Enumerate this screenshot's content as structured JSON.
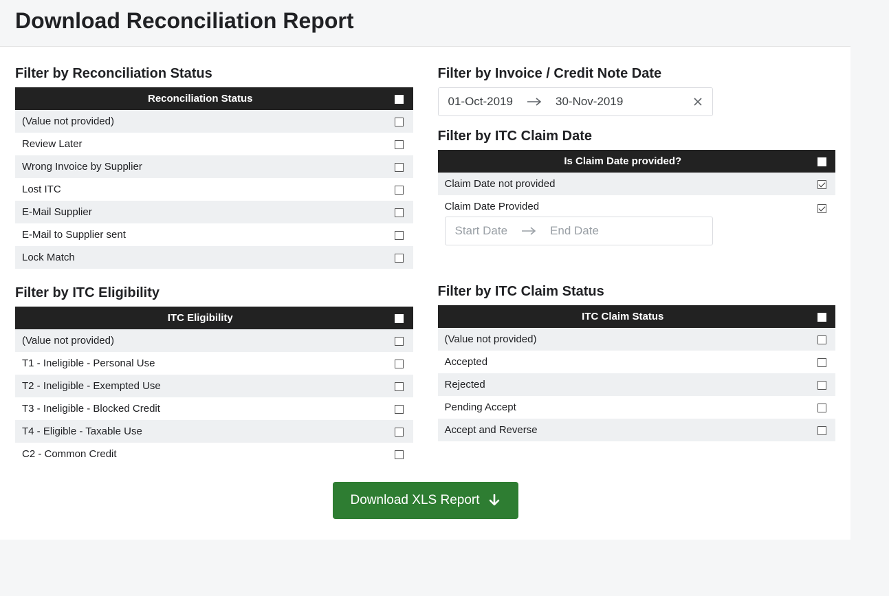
{
  "header": {
    "title": "Download Reconciliation Report"
  },
  "recon_status": {
    "title": "Filter by Reconciliation Status",
    "column_label": "Reconciliation Status",
    "rows": [
      {
        "label": "(Value not provided)",
        "checked": false
      },
      {
        "label": "Review Later",
        "checked": false
      },
      {
        "label": "Wrong Invoice by Supplier",
        "checked": false
      },
      {
        "label": "Lost ITC",
        "checked": false
      },
      {
        "label": "E-Mail Supplier",
        "checked": false
      },
      {
        "label": "E-Mail to Supplier sent",
        "checked": false
      },
      {
        "label": "Lock Match",
        "checked": false
      }
    ]
  },
  "invoice_date": {
    "title": "Filter by Invoice / Credit Note Date",
    "start": "01-Oct-2019",
    "end": "30-Nov-2019"
  },
  "claim_date": {
    "title": "Filter by ITC Claim Date",
    "column_label": "Is Claim Date provided?",
    "row_not_provided": {
      "label": "Claim Date not provided",
      "checked": true
    },
    "row_provided": {
      "label": "Claim Date Provided",
      "checked": true
    },
    "start_placeholder": "Start Date",
    "end_placeholder": "End Date"
  },
  "itc_eligibility": {
    "title": "Filter by ITC Eligibility",
    "column_label": "ITC Eligibility",
    "rows": [
      {
        "label": "(Value not provided)",
        "checked": false
      },
      {
        "label": "T1 - Ineligible - Personal Use",
        "checked": false
      },
      {
        "label": "T2 - Ineligible - Exempted Use",
        "checked": false
      },
      {
        "label": "T3 - Ineligible - Blocked Credit",
        "checked": false
      },
      {
        "label": "T4 - Eligible - Taxable Use",
        "checked": false
      },
      {
        "label": "C2 - Common Credit",
        "checked": false
      }
    ]
  },
  "claim_status": {
    "title": "Filter by ITC Claim Status",
    "column_label": "ITC Claim Status",
    "rows": [
      {
        "label": "(Value not provided)",
        "checked": false
      },
      {
        "label": "Accepted",
        "checked": false
      },
      {
        "label": "Rejected",
        "checked": false
      },
      {
        "label": "Pending Accept",
        "checked": false
      },
      {
        "label": "Accept and Reverse",
        "checked": false
      }
    ]
  },
  "download_button": {
    "label": "Download XLS Report"
  }
}
